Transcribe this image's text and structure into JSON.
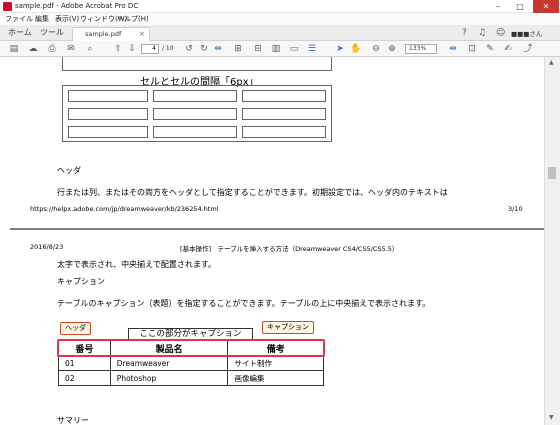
{
  "window": {
    "title": "sample.pdf - Adobe Acrobat Pro DC",
    "minimize_icon": "minimize-icon",
    "maximize_icon": "maximize-icon",
    "close_icon": "close-icon"
  },
  "menu": [
    "ファイル",
    "編集",
    "表示(V)",
    "ウィンドウ(W)",
    "ヘルプ(H)"
  ],
  "tabs": {
    "home": "ホーム",
    "tools": "ツール",
    "document": "sample.pdf"
  },
  "user": {
    "name": "■■■さん"
  },
  "toolbar": {
    "page_current": "4",
    "page_total": "/ 10",
    "zoom": "133%"
  },
  "page_top": {
    "caption_example": "セルとセルの間隔「6px」",
    "heading": "ヘッダ",
    "paragraph": "行または列、またはその両方をヘッダとして指定することができます。初期設定では、ヘッダ内のテキストは",
    "footer_url": "https://helpx.adobe.com/jp/dreamweaver/kb/236254.html",
    "footer_page": "3/10"
  },
  "page_bottom": {
    "header_date": "2016/8/23",
    "header_title": "[基本操作]　テーブルを挿入する方法（Dreamweaver CS4/CS5/CS5.5）",
    "line1": "太字で表示され、中央揃えで配置されます。",
    "heading": "キャプション",
    "paragraph": "テーブルのキャプション（表題）を指定することができます。テーブルの上に中央揃えで表示されます。",
    "label_header": "ヘッダ",
    "label_caption": "キャプション",
    "caption_text": "ここの部分がキャプション",
    "table_headers": [
      "番号",
      "製品名",
      "備考"
    ],
    "table_rows": [
      [
        "01",
        "Dreamweaver",
        "サイト制作"
      ],
      [
        "02",
        "Photoshop",
        "画像編集"
      ]
    ],
    "next_heading": "サマリー"
  }
}
